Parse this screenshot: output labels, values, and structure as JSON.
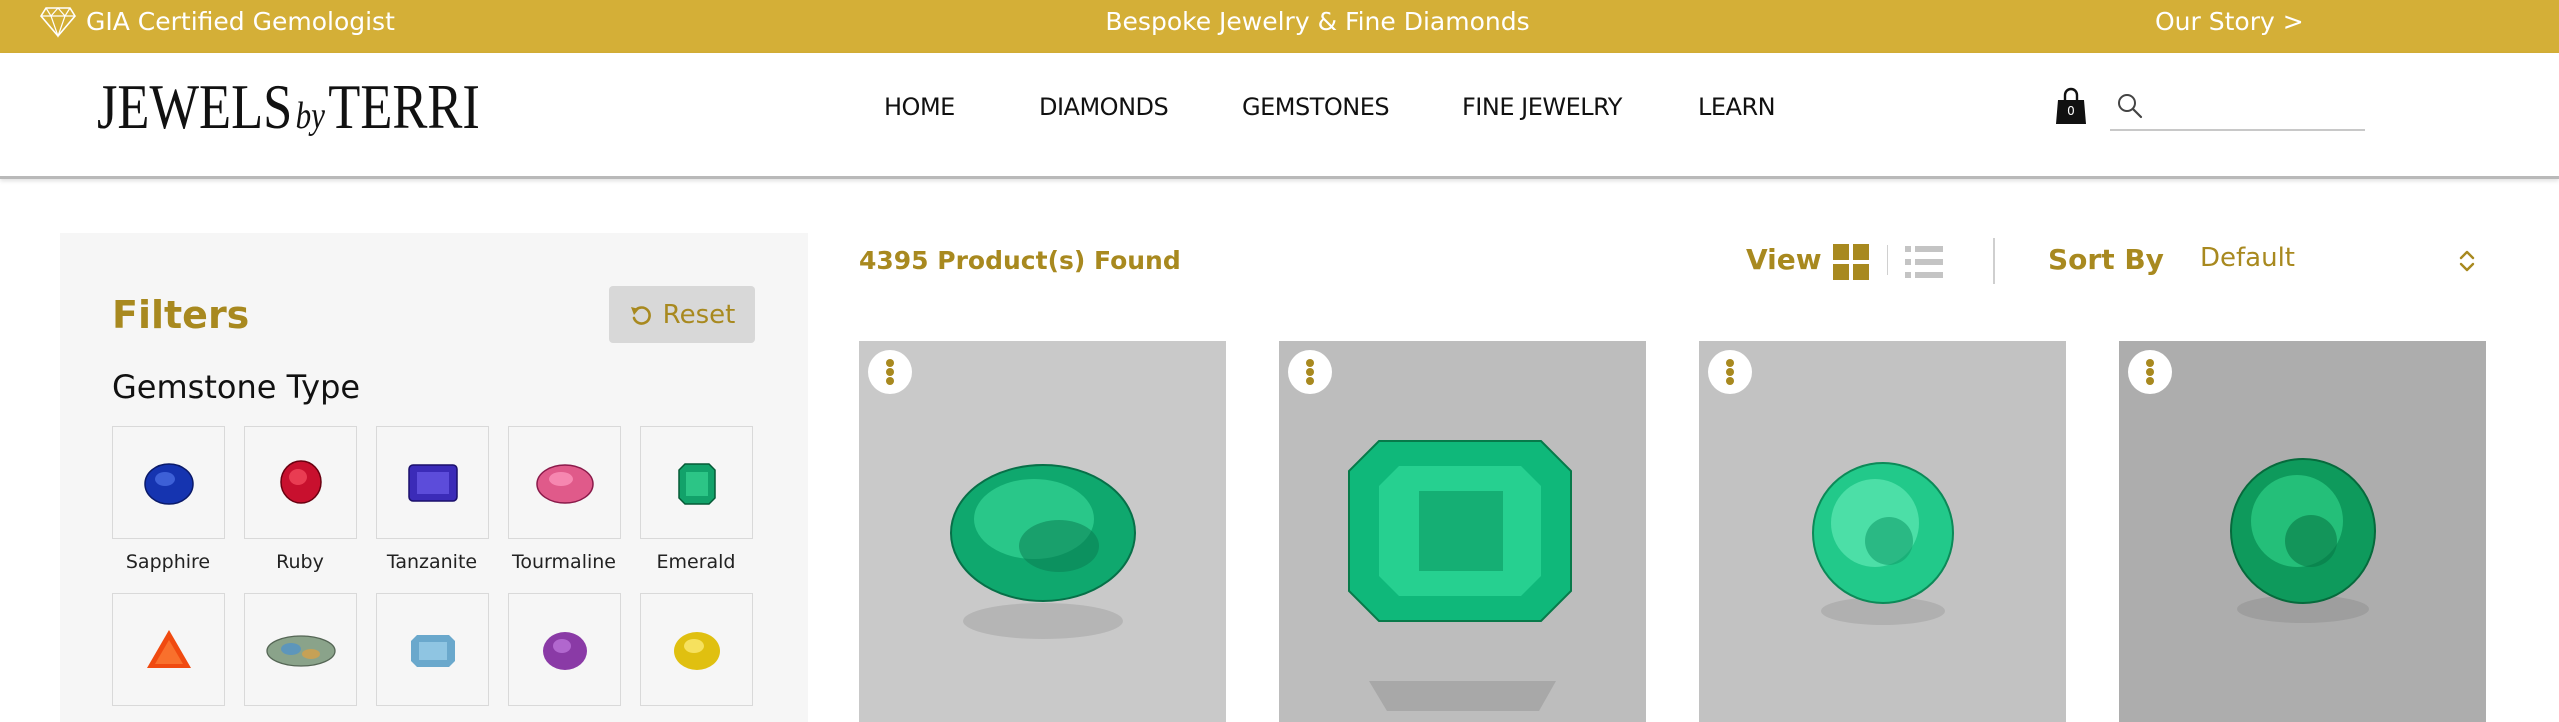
{
  "topbar": {
    "left_text": "GIA Certified Gemologist",
    "left_icon": "diamond-outline-icon",
    "center_text": "Bespoke Jewelry & Fine Diamonds",
    "right_link": "Our Story >"
  },
  "header": {
    "logo": {
      "part1": "JEWELS",
      "part2": "by",
      "part3": "TERRI"
    },
    "nav": [
      "HOME",
      "DIAMONDS",
      "GEMSTONES",
      "FINE JEWELRY",
      "LEARN"
    ],
    "cart_count": "0",
    "cart_icon": "shopping-bag-icon",
    "search_icon": "magnifier-icon",
    "search_value": ""
  },
  "filters": {
    "title": "Filters",
    "reset_label": "Reset",
    "reset_icon": "undo-arrow-icon",
    "gemstone_type_title": "Gemstone Type",
    "gemstones": [
      {
        "name": "Sapphire",
        "color": "#1534b0"
      },
      {
        "name": "Ruby",
        "color": "#c8102e"
      },
      {
        "name": "Tanzanite",
        "color": "#3b2bb8"
      },
      {
        "name": "Tourmaline",
        "color": "#e05a8a"
      },
      {
        "name": "Emerald",
        "color": "#12a26a"
      },
      {
        "name": "",
        "color": "#f04a10"
      },
      {
        "name": "",
        "color": "#8aa38a"
      },
      {
        "name": "",
        "color": "#6aa8cc"
      },
      {
        "name": "",
        "color": "#8a3aa6"
      },
      {
        "name": "",
        "color": "#e0c010"
      }
    ]
  },
  "results": {
    "found_text": "4395 Product(s) Found",
    "view_label": "View",
    "grid_icon": "grid-view-icon",
    "list_icon": "list-view-icon",
    "sort_label": "Sort By",
    "sort_value": "Default",
    "sort_icon": "up-down-chevron-icon"
  },
  "products": [
    {
      "gem": "emerald",
      "cut": "oval",
      "bg": "#c9c9c9"
    },
    {
      "gem": "emerald",
      "cut": "emerald-cut",
      "bg": "#bdbdbd"
    },
    {
      "gem": "emerald",
      "cut": "round",
      "bg": "#c2c2c2"
    },
    {
      "gem": "emerald",
      "cut": "round",
      "bg": "#adadad"
    }
  ],
  "colors": {
    "gold": "#d4af37",
    "gold_text": "#a8891f",
    "sidebar_bg": "#f6f6f6"
  }
}
